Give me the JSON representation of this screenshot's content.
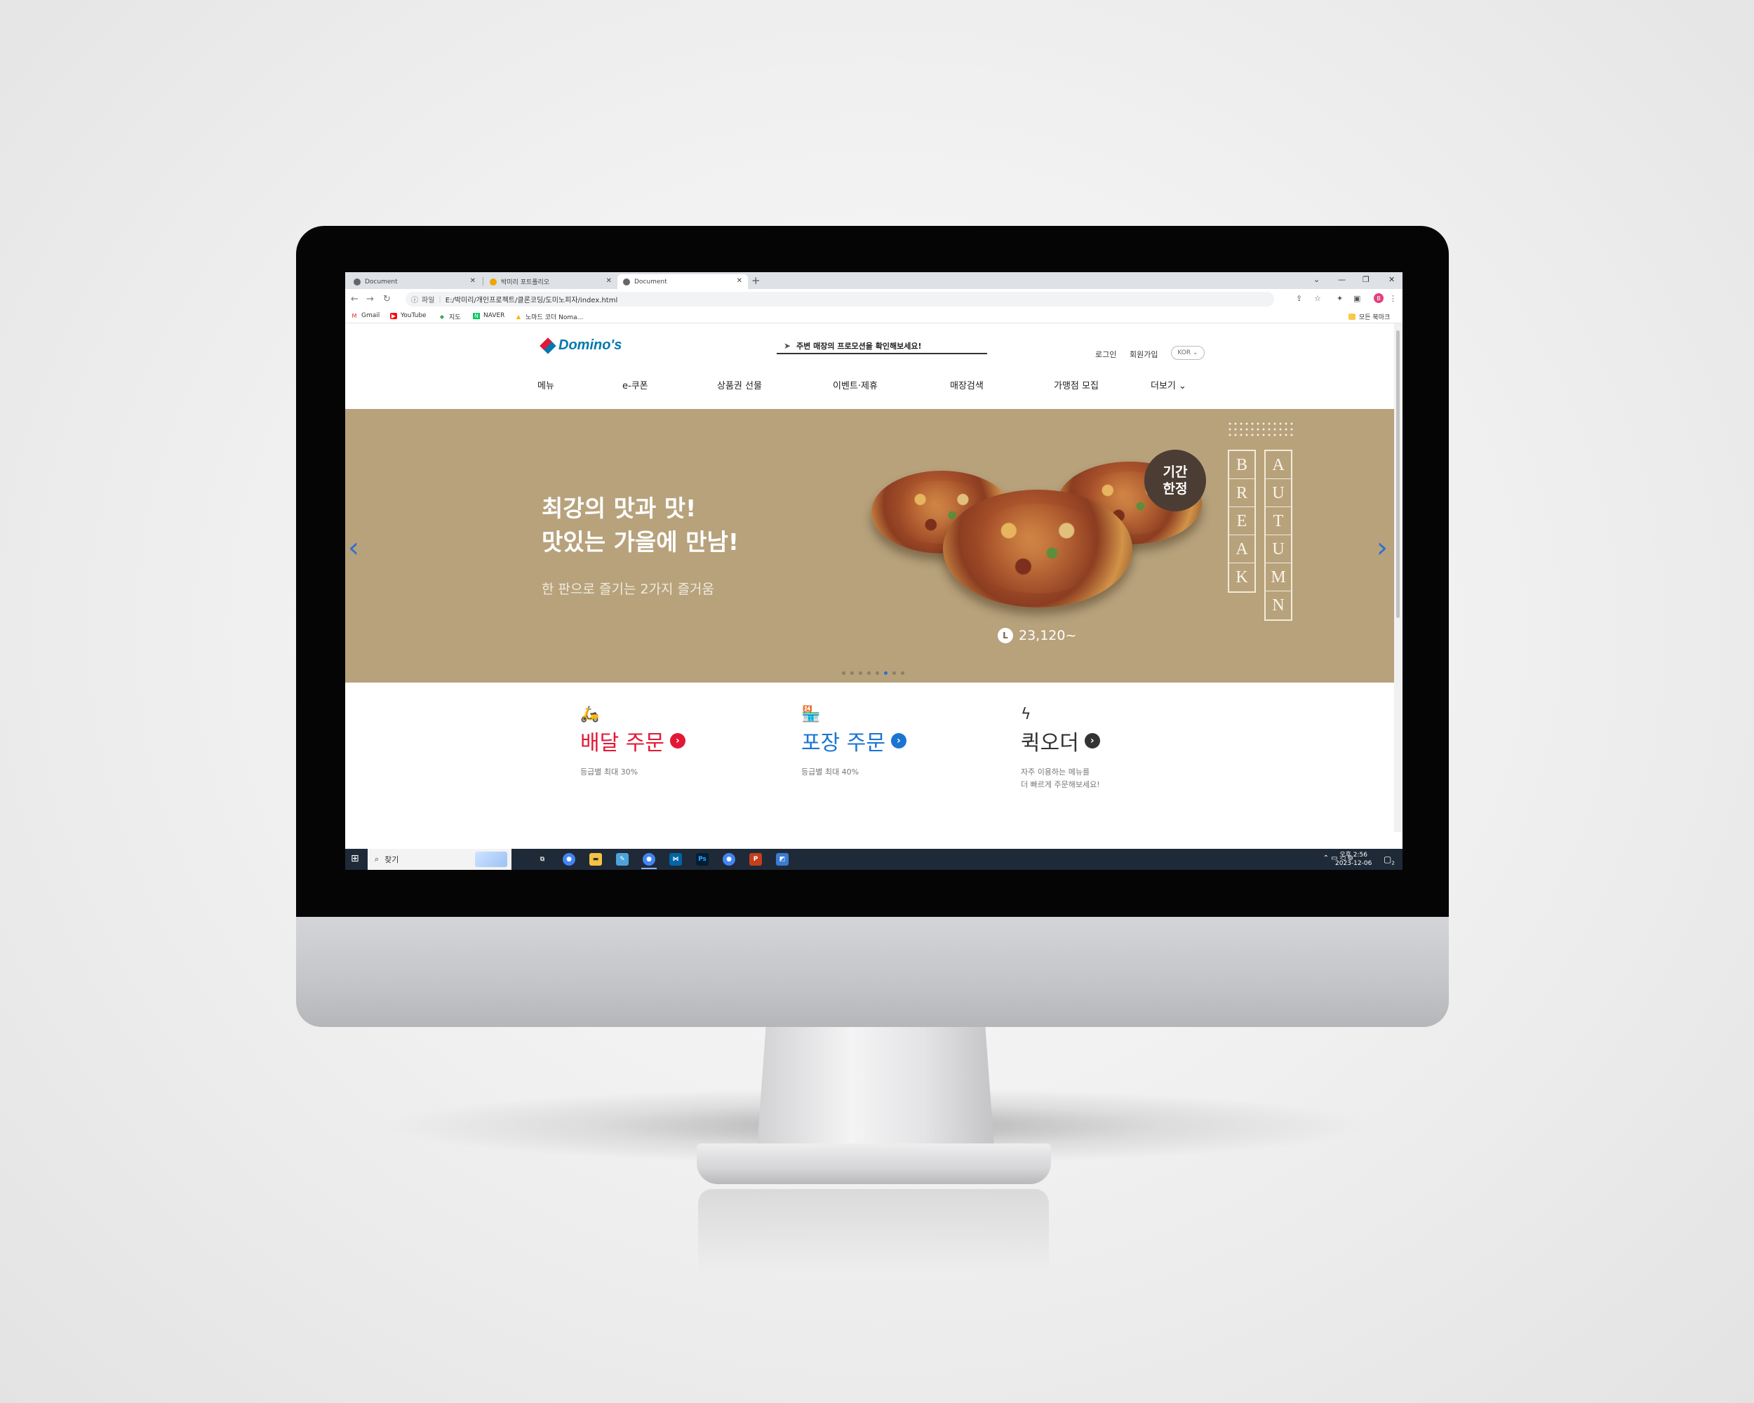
{
  "browser": {
    "tabs": [
      {
        "title": "Document",
        "active": false
      },
      {
        "title": "박미리 포트폴리오",
        "active": false
      },
      {
        "title": "Document",
        "active": true
      }
    ],
    "new_tab": "+",
    "window_controls": {
      "minimize": "—",
      "restore": "❐",
      "close": "✕",
      "dropdown": "⌄"
    },
    "address": {
      "scheme_label": "파일",
      "url": "E:/박미리/개인프로젝트/클론코딩/도미노피자/index.html"
    },
    "profile_initial": "B",
    "bookmarks": [
      "Gmail",
      "YouTube",
      "지도",
      "NAVER",
      "노마드 코더 Noma..."
    ],
    "all_bookmarks": "모든 북마크"
  },
  "site": {
    "brand": "Domino's",
    "promo_search": "주변 매장의 프로모션을 확인해보세요!",
    "login": "로그인",
    "signup": "회원가입",
    "language": "KOR",
    "nav": [
      "메뉴",
      "e-쿠폰",
      "상품권 선물",
      "이벤트·제휴",
      "매장검색",
      "가맹점 모집",
      "더보기"
    ],
    "hero": {
      "line1": "최강의 맛과 맛!",
      "line2": "맛있는 가을에 만남!",
      "subtitle": "한 판으로 즐기는 2가지 즐거움",
      "badge_line1": "기간",
      "badge_line2": "한정",
      "price_size": "L",
      "price": "23,120~",
      "word1": [
        "B",
        "R",
        "E",
        "A",
        "K"
      ],
      "word2": [
        "A",
        "U",
        "T",
        "U",
        "M",
        "N"
      ],
      "slides_total": 8,
      "active_slide": 6
    },
    "orders": [
      {
        "title": "배달 주문",
        "desc": "등급별 최대 30%",
        "color": "#e31837",
        "icon": "scooter-icon"
      },
      {
        "title": "포장 주문",
        "desc": "등급별 최대 40%",
        "color": "#1a75d2",
        "icon": "store-icon"
      },
      {
        "title": "퀵오더",
        "desc": "자주 이용하는 메뉴를",
        "desc2": "더 빠르게 주문해보세요!",
        "color": "#333333",
        "icon": "lightning-icon"
      }
    ]
  },
  "taskbar": {
    "search_placeholder": "찾기",
    "clock_time": "오후 2:56",
    "clock_date": "2023-12-06",
    "notification_count": "2"
  },
  "colors": {
    "brand_blue": "#0078ae",
    "brand_red": "#e31837",
    "hero_bg": "#b7a27c"
  }
}
